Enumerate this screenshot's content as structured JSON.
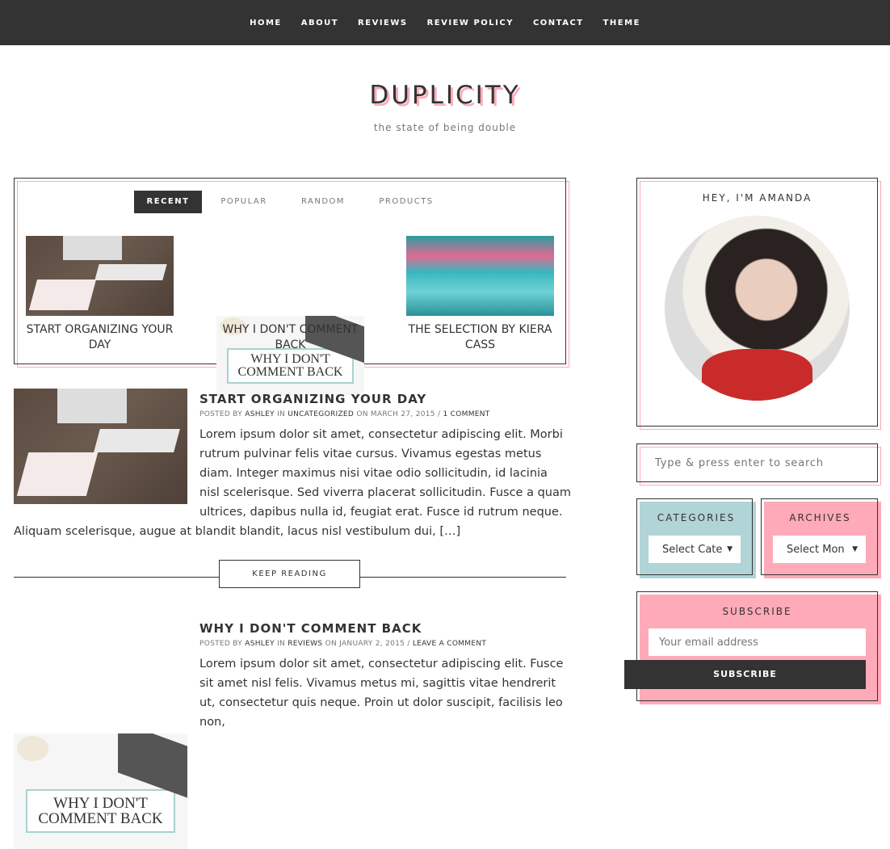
{
  "nav": {
    "items": [
      "HOME",
      "ABOUT",
      "REVIEWS",
      "REVIEW POLICY",
      "CONTACT",
      "THEME"
    ]
  },
  "site": {
    "title": "DUPLICITY",
    "tagline": "the state of being double"
  },
  "featured": {
    "tabs": [
      "RECENT",
      "POPULAR",
      "RANDOM",
      "PRODUCTS"
    ],
    "active_tab": "RECENT",
    "items": [
      {
        "title": "START ORGANIZING YOUR DAY"
      },
      {
        "title": "WHY I DON'T COMMENT BACK",
        "image_text": "WHY I DON'T COMMENT BACK"
      },
      {
        "title": "THE SELECTION BY KIERA CASS"
      }
    ]
  },
  "posts": [
    {
      "title": "START ORGANIZING YOUR DAY",
      "posted_by": "POSTED BY",
      "author": "ASHLEY",
      "in": "IN",
      "category": "UNCATEGORIZED",
      "on": "ON MARCH 27, 2015 /",
      "comments": "1 COMMENT",
      "excerpt": "Lorem ipsum dolor sit amet, consectetur adipiscing elit. Morbi rutrum pulvinar felis vitae cursus. Vivamus egestas metus diam. Integer maximus nisi vitae odio sollicitudin, id lacinia nisl scelerisque. Sed viverra placerat sollicitudin. Fusce a quam ultrices, dapibus nulla id, feugiat erat. Fusce id rutrum neque. Aliquam scelerisque, augue at blandit blandit, lacus nisl vestibulum dui, […]",
      "keep_reading": "KEEP READING"
    },
    {
      "title": "WHY I DON'T COMMENT BACK",
      "posted_by": "POSTED BY",
      "author": "ASHLEY",
      "in": "IN",
      "category": "REVIEWS",
      "on": "ON JANUARY 2, 2015 /",
      "comments": "LEAVE A COMMENT",
      "image_text": "WHY I DON'T COMMENT BACK",
      "excerpt": "Lorem ipsum dolor sit amet, consectetur adipiscing elit. Fusce sit amet nisl felis. Vivamus metus mi, sagittis vitae hendrerit ut, consectetur quis neque. Proin ut dolor suscipit, facilisis leo non,"
    }
  ],
  "sidebar": {
    "about_title": "HEY, I'M AMANDA",
    "search_placeholder": "Type & press enter to search",
    "categories": {
      "title": "CATEGORIES",
      "selected": "Select Cate"
    },
    "archives": {
      "title": "ARCHIVES",
      "selected": "Select Mon"
    },
    "subscribe": {
      "title": "SUBSCRIBE",
      "placeholder": "Your email address",
      "button": "SUBSCRIBE"
    }
  },
  "colors": {
    "dark": "#333333",
    "pink": "#ffaab8",
    "teal": "#b1d4d6"
  }
}
